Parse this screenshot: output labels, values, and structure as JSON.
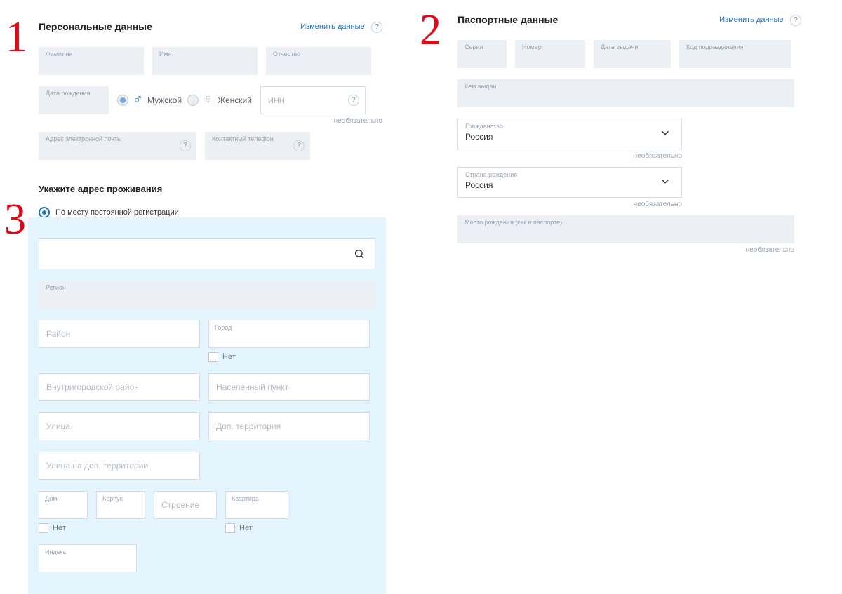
{
  "numbers": {
    "n1": "1",
    "n2": "2",
    "n3": "3"
  },
  "personal": {
    "title": "Персональные данные",
    "edit": "Изменить данные",
    "fields": {
      "lastname": "Фамилия",
      "firstname": "Имя",
      "patronymic": "Отчество",
      "dob": "Дата рождения",
      "male": "Мужской",
      "female": "Женский",
      "inn": "ИНН",
      "inn_opt": "необязательно",
      "email": "Адрес электронной почты",
      "phone": "Контактный телефон"
    }
  },
  "passport": {
    "title": "Паспортные данные",
    "edit": "Изменить данные",
    "fields": {
      "series": "Серия",
      "number": "Номер",
      "issue_date": "Дата выдачи",
      "dept_code": "Код подразделения",
      "issued_by": "Кем выдан",
      "citizenship_lbl": "Гражданство",
      "citizenship_val": "Россия",
      "citizenship_opt": "необязательно",
      "birth_country_lbl": "Страна рождения",
      "birth_country_val": "Россия",
      "birth_country_opt": "необязательно",
      "birth_place_lbl": "Место рождения (как в паспорте)",
      "birth_place_opt": "необязательно"
    }
  },
  "address": {
    "title": "Укажите адрес проживания",
    "radio": "По месту постоянной регистрации",
    "fields": {
      "region": "Регион",
      "district": "Район",
      "city": "Город",
      "city_no": "Нет",
      "intra": "Внутригородской район",
      "settlement": "Населенный пункт",
      "street": "Улица",
      "addl_terr": "Доп. территория",
      "addl_street": "Улица на доп. территории",
      "house": "Дом",
      "house_no": "Нет",
      "korpus": "Корпус",
      "building": "Строение",
      "apt": "Квартира",
      "apt_no": "Нет",
      "index": "Индекс"
    }
  }
}
